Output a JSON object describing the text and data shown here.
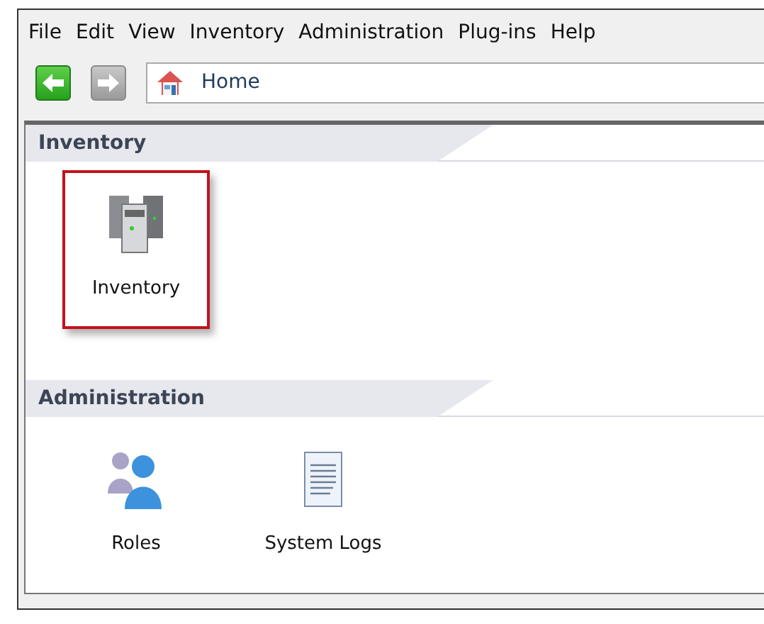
{
  "menu": [
    "File",
    "Edit",
    "View",
    "Inventory",
    "Administration",
    "Plug-ins",
    "Help"
  ],
  "nav": {
    "back_disabled": false,
    "forward_disabled": true,
    "address": "Home"
  },
  "sections": [
    {
      "title": "Inventory",
      "items": [
        {
          "label": "Inventory",
          "kind": "servers",
          "highlighted": true
        }
      ]
    },
    {
      "title": "Administration",
      "items": [
        {
          "label": "Roles",
          "kind": "people",
          "highlighted": false
        },
        {
          "label": "System Logs",
          "kind": "document",
          "highlighted": false
        }
      ]
    }
  ]
}
